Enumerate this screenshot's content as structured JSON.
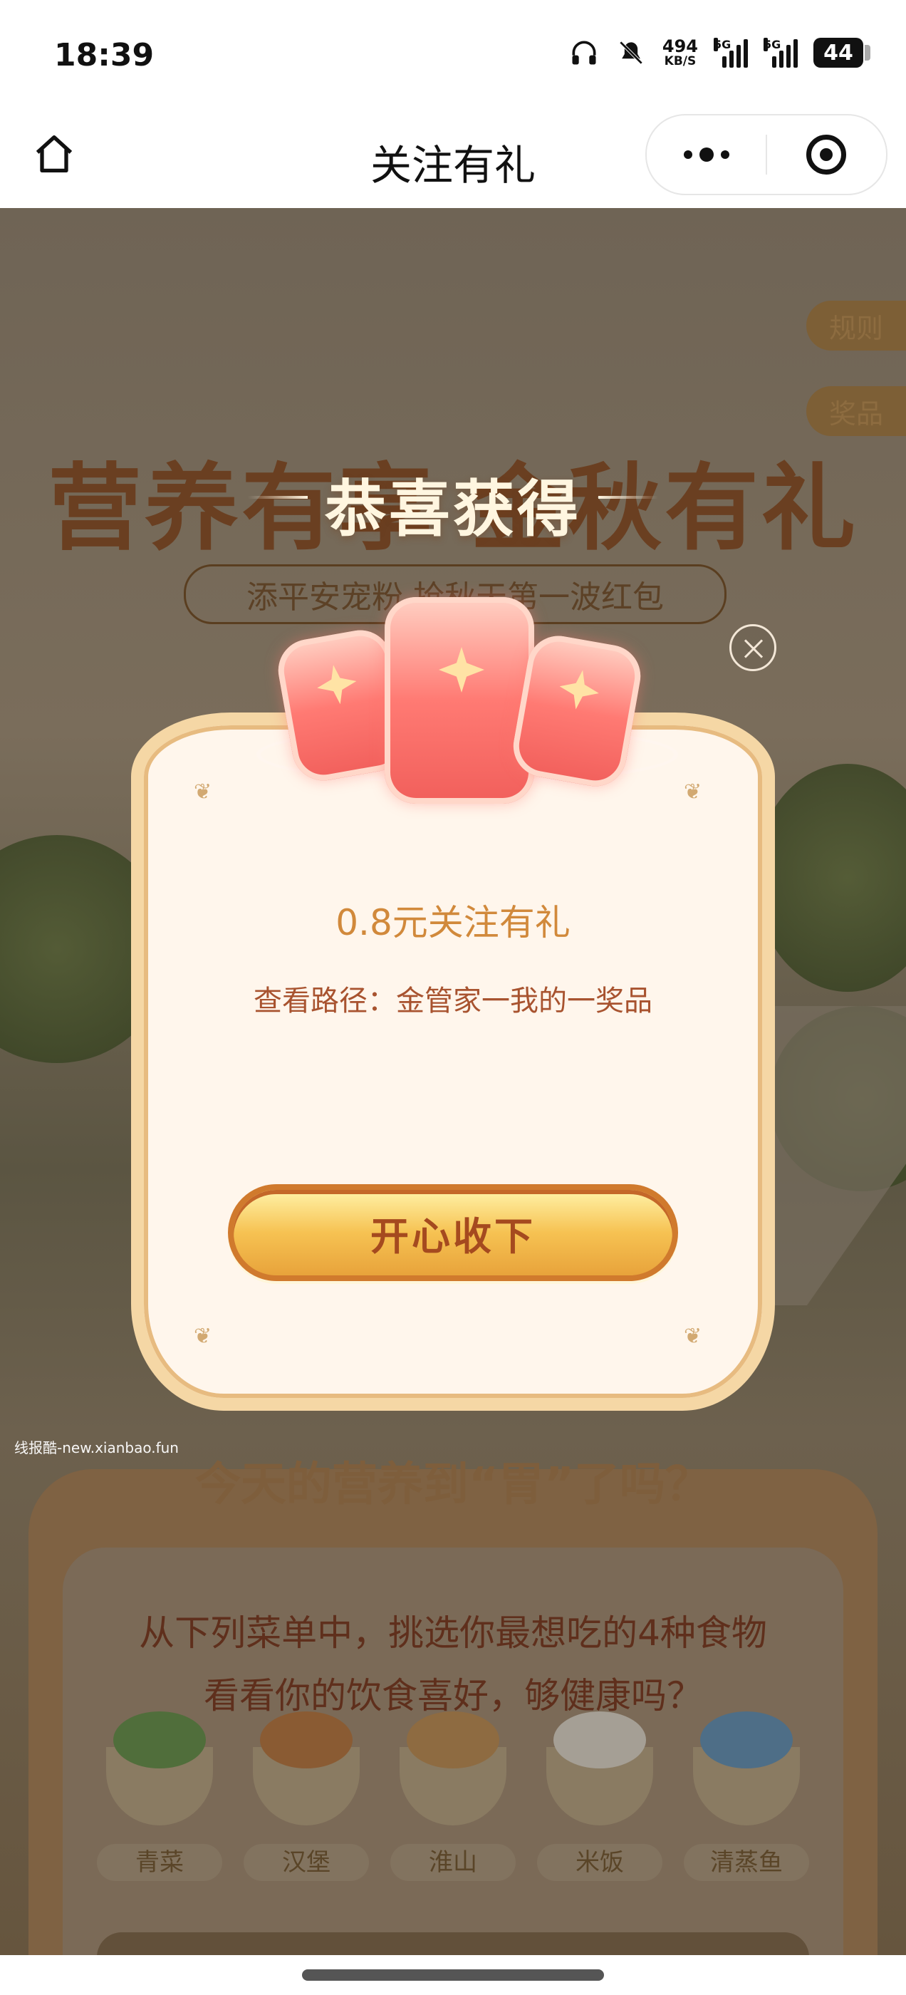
{
  "status": {
    "time": "18:39",
    "speed_value": "494",
    "speed_unit": "KB/S",
    "network_1": "5G",
    "network_2": "5G",
    "battery": "44"
  },
  "nav": {
    "title": "关注有礼",
    "more_icon": "more-icon",
    "close_icon": "target-icon",
    "home_icon": "home-icon"
  },
  "background": {
    "headline": "营养有享 金秋有礼",
    "sub_banner": "添平安宠粉 抢秋天第一波红包",
    "rules_chip": "规则",
    "prize_chip": "奖品",
    "section_title": "今天的营养到“胃”了吗？",
    "question_line_1": "从下列菜单中，挑选你最想吃的4种食物",
    "question_line_2": "看看你的饮食喜好，够健康吗？",
    "foods": [
      "青菜",
      "汉堡",
      "淮山",
      "米饭",
      "清蒸鱼"
    ]
  },
  "modal": {
    "title": "恭喜获得",
    "reward": "0.8元关注有礼",
    "path": "查看路径：金管家一我的一奖品",
    "button": "开心收下",
    "close_icon": "close-icon"
  },
  "watermark": "线报酷-new.xianbao.fun",
  "colors": {
    "accent": "#d1893b",
    "button_text": "#a54a1f",
    "modal_bg": "#fff6ec"
  }
}
